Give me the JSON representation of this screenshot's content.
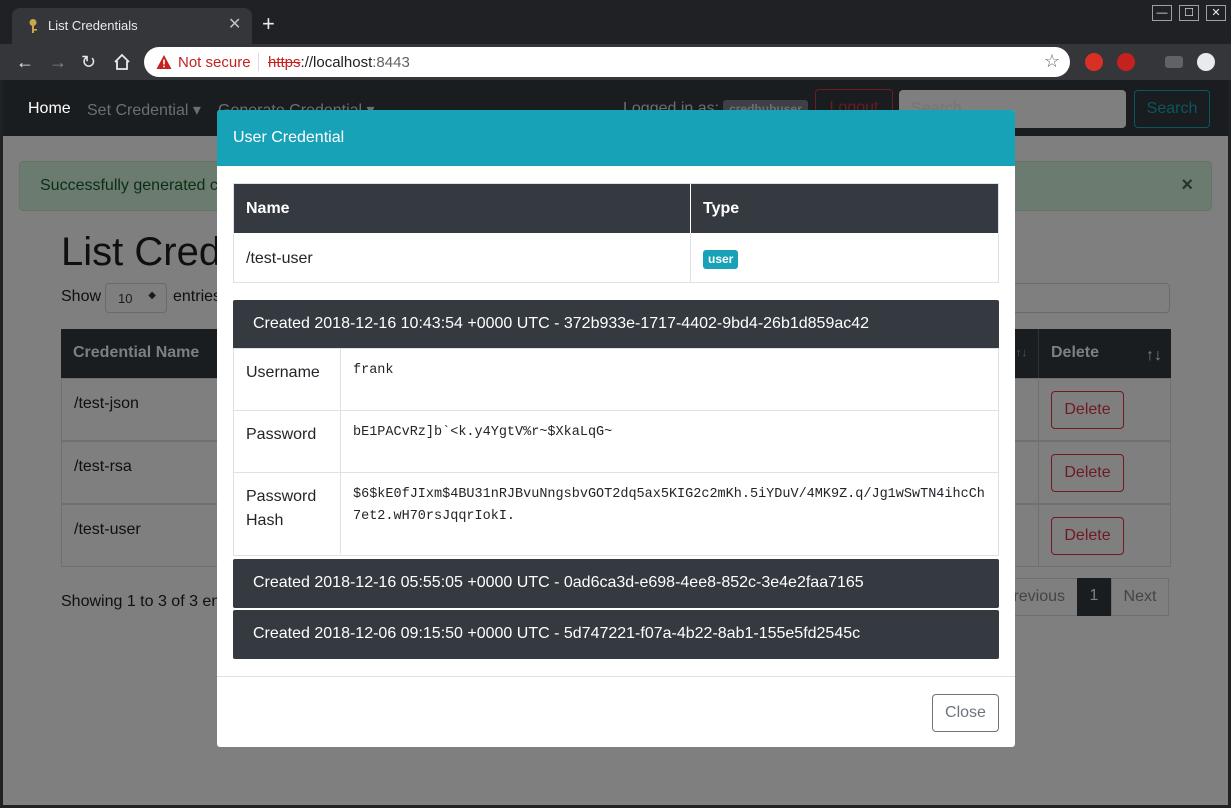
{
  "browser": {
    "tab_title": "List Credentials",
    "new_tab": "+",
    "close_tab": "✕",
    "security_label": "Not secure",
    "url_scheme": "https",
    "url_host": "://localhost",
    "url_port": ":8443",
    "minimize": "—",
    "maximize": "☐",
    "close_window": "✕"
  },
  "navbar": {
    "home": "Home",
    "set_credential": "Set Credential ▾",
    "generate_credential": "Generate Credential ▾",
    "logged_in_as": "Logged in as:",
    "username": "credhubuser",
    "logout": "Logout",
    "search_placeholder": "Search",
    "search_button": "Search"
  },
  "alert": {
    "text": "Successfully generated c",
    "close": "×"
  },
  "page": {
    "title": "List Cred",
    "show_label": "Show",
    "show_value": "10",
    "entries_label": "entries",
    "table": {
      "header_name": "Credential Name",
      "header_delete": "Delete",
      "sort_glyph": "↑↓",
      "rows": [
        {
          "name": "/test-json",
          "delete": "Delete"
        },
        {
          "name": "/test-rsa",
          "delete": "Delete"
        },
        {
          "name": "/test-user",
          "delete": "Delete"
        }
      ]
    },
    "showing": "Showing 1 to 3 of 3 en",
    "pagination": {
      "previous": "revious",
      "current": "1",
      "next": "Next"
    }
  },
  "modal": {
    "title": "User Credential",
    "info": {
      "header_name": "Name",
      "header_type": "Type",
      "name": "/test-user",
      "type": "user"
    },
    "versions": [
      {
        "created": "Created 2018-12-16 10:43:54 +0000 UTC - 372b933e-1717-4402-9bd4-26b1d859ac42",
        "details": [
          {
            "key": "Username",
            "value": "frank"
          },
          {
            "key": "Password",
            "value": "bE1PACvRz]b`<k.y4YgtV%r~$XkaLqG~"
          },
          {
            "key": "Password Hash",
            "value": "$6$kE0fJIxm$4BU31nRJBvuNngsbvGOT2dq5ax5KIG2c2mKh.5iYDuV/4MK9Z.q/Jg1wSwTN4ihcCh7et2.wH70rsJqqrIokI."
          }
        ]
      },
      {
        "created": "Created 2018-12-16 05:55:05 +0000 UTC - 0ad6ca3d-e698-4ee8-852c-3e4e2faa7165"
      },
      {
        "created": "Created 2018-12-06 09:15:50 +0000 UTC - 5d747221-f07a-4b22-8ab1-155e5fd2545c"
      }
    ],
    "close_button": "Close"
  },
  "colors": {
    "modal_header": "#17a2b8",
    "dark_header": "#343a40",
    "danger": "#dc3545",
    "security_warning": "#c5221f"
  }
}
